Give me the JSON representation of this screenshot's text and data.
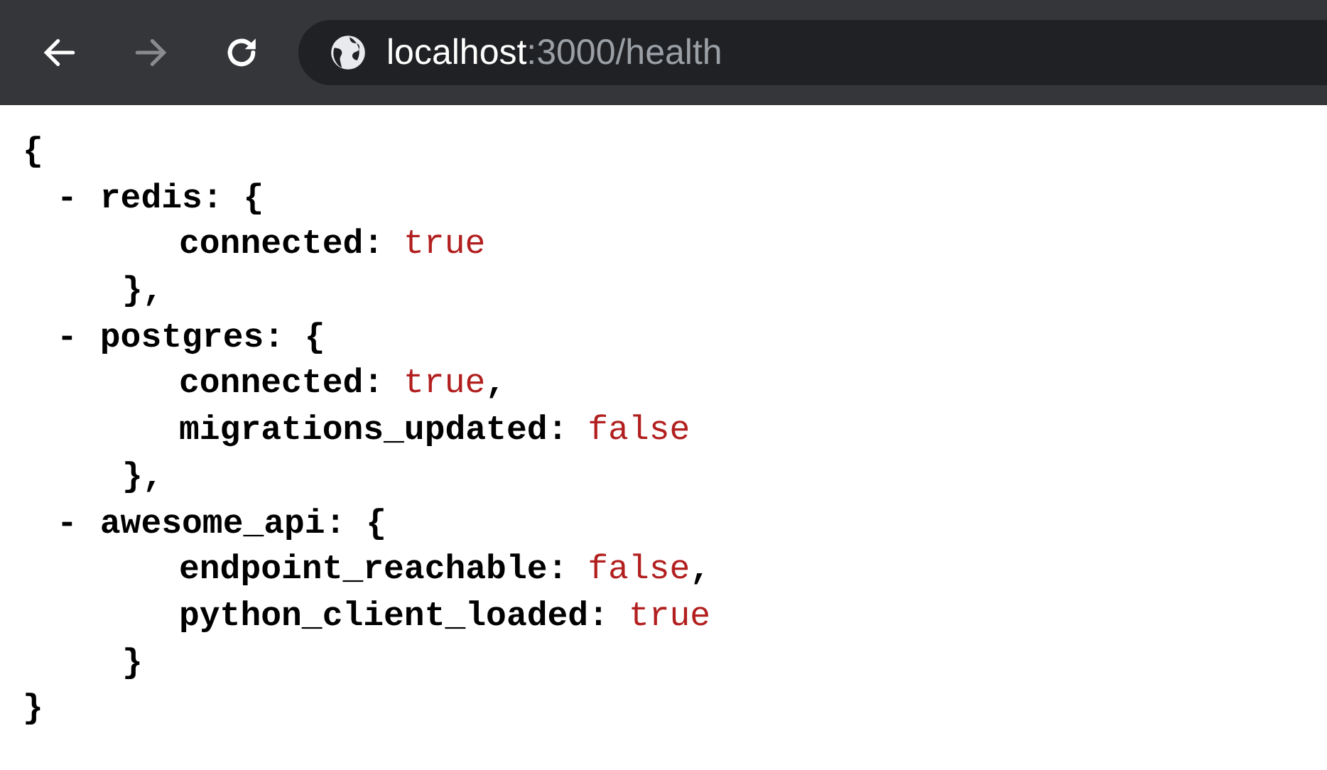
{
  "toolbar": {
    "back_disabled": false,
    "forward_disabled": true,
    "url": {
      "host": "localhost",
      "rest": ":3000/health"
    }
  },
  "document": {
    "open": "{",
    "close": "}",
    "sections": [
      {
        "bullet": "-",
        "header": "redis: {",
        "close": "},",
        "fields": [
          {
            "key": "connected:",
            "value": "true"
          }
        ]
      },
      {
        "bullet": "-",
        "header": "postgres: {",
        "close": "},",
        "fields": [
          {
            "key": "connected:",
            "value": "true",
            "punct": ","
          },
          {
            "key": "migrations_updated:",
            "value": "false"
          }
        ]
      },
      {
        "bullet": "-",
        "header": "awesome_api: {",
        "close": "}",
        "fields": [
          {
            "key": "endpoint_reachable:",
            "value": "false",
            "punct": ","
          },
          {
            "key": "python_client_loaded:",
            "value": "true"
          }
        ]
      }
    ]
  }
}
